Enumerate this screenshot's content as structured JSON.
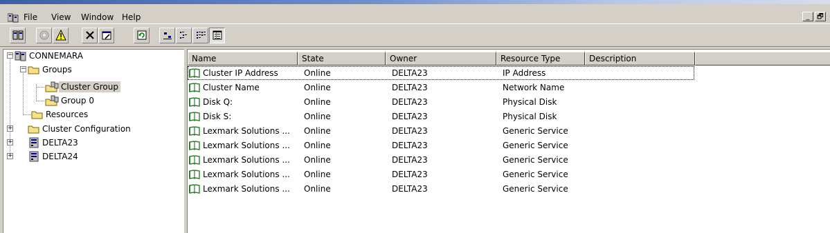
{
  "menu": {
    "items": [
      "File",
      "View",
      "Window",
      "Help"
    ],
    "mdi_controls": [
      "_",
      "🗗"
    ]
  },
  "toolbar": {
    "groups": [
      [
        "cluster-icon"
      ],
      [
        "bring-online-icon",
        "warning-icon"
      ],
      [
        "delete-icon",
        "properties-icon"
      ],
      [
        "refresh-icon"
      ],
      [
        "large-icons-view-icon",
        "small-icons-view-icon",
        "list-view-icon",
        "details-view-icon"
      ]
    ]
  },
  "tree": {
    "nodes": [
      {
        "label": "CONNEMARA",
        "icon": "cluster-icon",
        "expander": "−"
      },
      {
        "label": "Groups",
        "icon": "folder-icon",
        "expander": "−"
      },
      {
        "label": "Cluster Group",
        "icon": "group-icon",
        "selected": true
      },
      {
        "label": "Group 0",
        "icon": "group-icon"
      },
      {
        "label": "Resources",
        "icon": "folder-icon"
      },
      {
        "label": "Cluster Configuration",
        "icon": "folder-icon",
        "expander": "+"
      },
      {
        "label": "DELTA23",
        "icon": "server-icon",
        "expander": "+"
      },
      {
        "label": "DELTA24",
        "icon": "server-icon",
        "expander": "+"
      }
    ]
  },
  "list": {
    "columns": [
      "Name",
      "State",
      "Owner",
      "Resource Type",
      "Description"
    ],
    "rows": [
      {
        "name": "Cluster IP Address",
        "state": "Online",
        "owner": "DELTA23",
        "type": "IP Address",
        "description": ""
      },
      {
        "name": "Cluster Name",
        "state": "Online",
        "owner": "DELTA23",
        "type": "Network Name",
        "description": ""
      },
      {
        "name": "Disk Q:",
        "state": "Online",
        "owner": "DELTA23",
        "type": "Physical Disk",
        "description": ""
      },
      {
        "name": "Disk S:",
        "state": "Online",
        "owner": "DELTA23",
        "type": "Physical Disk",
        "description": ""
      },
      {
        "name": "Lexmark Solutions ...",
        "state": "Online",
        "owner": "DELTA23",
        "type": "Generic Service",
        "description": ""
      },
      {
        "name": "Lexmark Solutions ...",
        "state": "Online",
        "owner": "DELTA23",
        "type": "Generic Service",
        "description": ""
      },
      {
        "name": "Lexmark Solutions ...",
        "state": "Online",
        "owner": "DELTA23",
        "type": "Generic Service",
        "description": ""
      },
      {
        "name": "Lexmark Solutions ...",
        "state": "Online",
        "owner": "DELTA23",
        "type": "Generic Service",
        "description": ""
      },
      {
        "name": "Lexmark Solutions ...",
        "state": "Online",
        "owner": "DELTA23",
        "type": "Generic Service",
        "description": ""
      }
    ]
  },
  "colors": {
    "window_bg": "#d4d0c8",
    "title_gradient_start": "#3a5ea7",
    "resource_icon_green": "#2e7d2e"
  }
}
